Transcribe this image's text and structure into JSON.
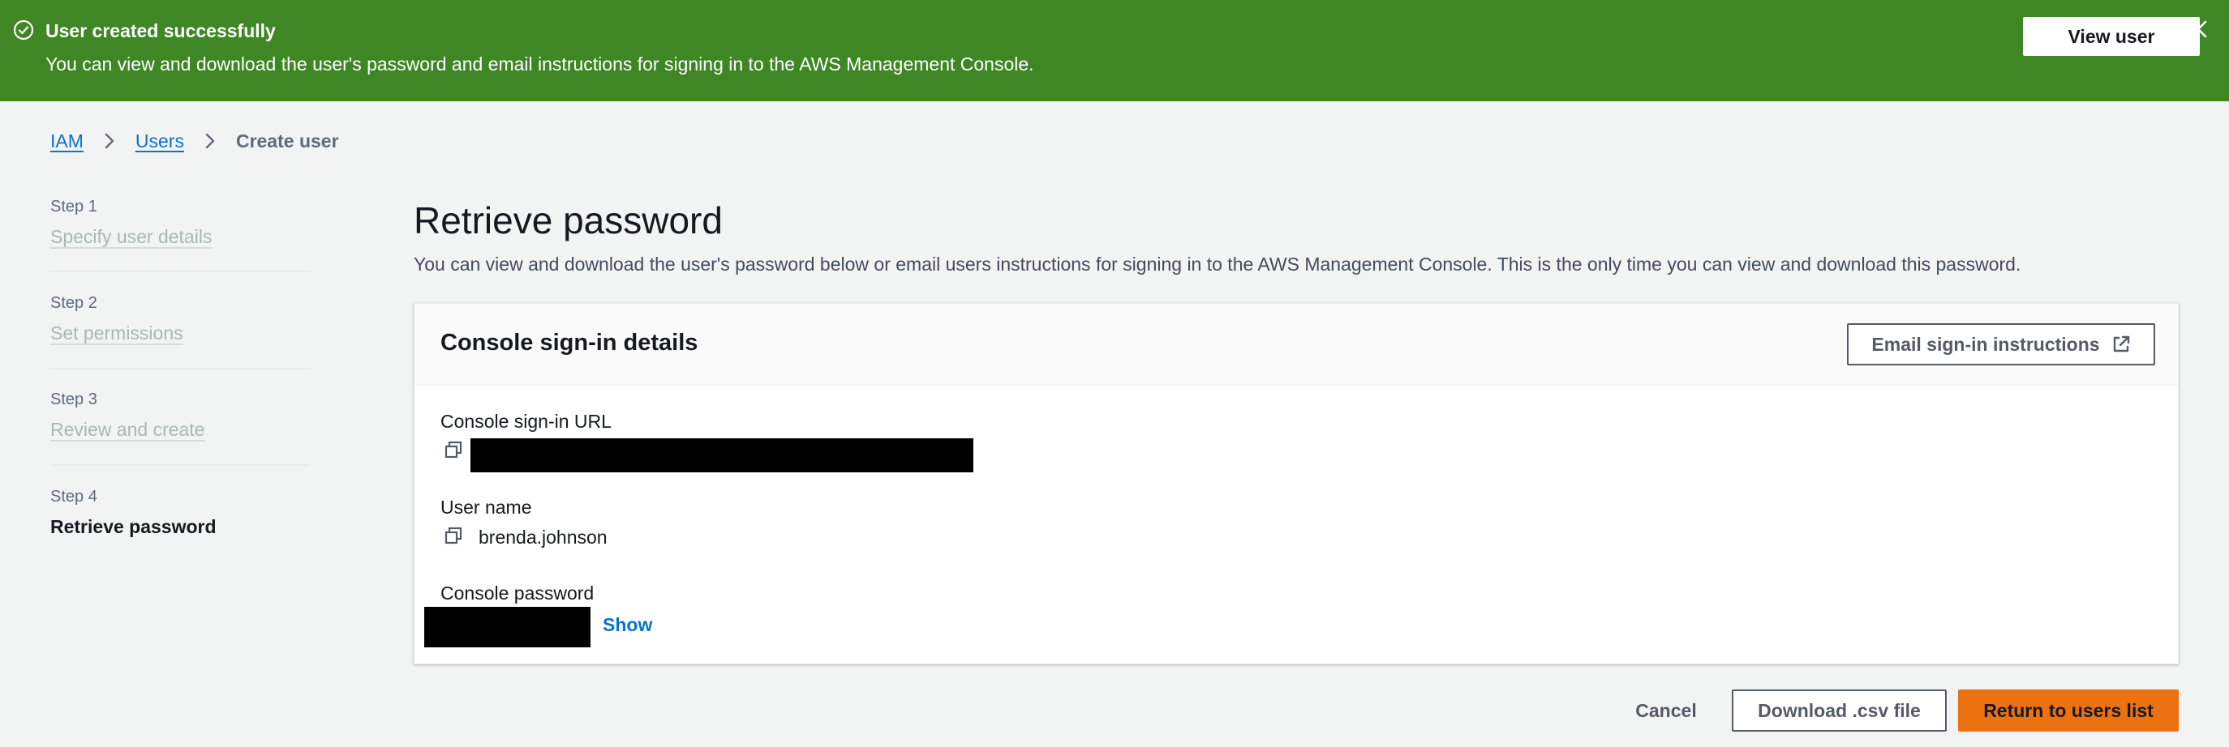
{
  "flash": {
    "title": "User created successfully",
    "message": "You can view and download the user's password and email instructions for signing in to the AWS Management Console.",
    "view_user_label": "View user",
    "icons": {
      "status": "check-circle-icon",
      "close": "close-icon"
    },
    "background": "#3f8624"
  },
  "breadcrumb": {
    "items": [
      {
        "label": "IAM"
      },
      {
        "label": "Users"
      },
      {
        "label": "Create user"
      }
    ]
  },
  "steps": [
    {
      "number": "Step 1",
      "label": "Specify user details"
    },
    {
      "number": "Step 2",
      "label": "Set permissions"
    },
    {
      "number": "Step 3",
      "label": "Review and create"
    },
    {
      "number": "Step 4",
      "label": "Retrieve password"
    }
  ],
  "main": {
    "title": "Retrieve password",
    "description": "You can view and download the user's password below or email users instructions for signing in to the AWS Management Console. This is the only time you can view and download this password."
  },
  "card": {
    "title": "Console sign-in details",
    "email_button_label": "Email sign-in instructions",
    "fields": {
      "url_label": "Console sign-in URL",
      "username_label": "User name",
      "username_value": "brenda.johnson",
      "password_label": "Console password",
      "show_label": "Show"
    }
  },
  "actions": {
    "cancel_label": "Cancel",
    "download_label": "Download .csv file",
    "return_label": "Return to users list"
  },
  "colors": {
    "link": "#0972d3",
    "primary_button": "#ec7211",
    "success": "#3f8624"
  }
}
